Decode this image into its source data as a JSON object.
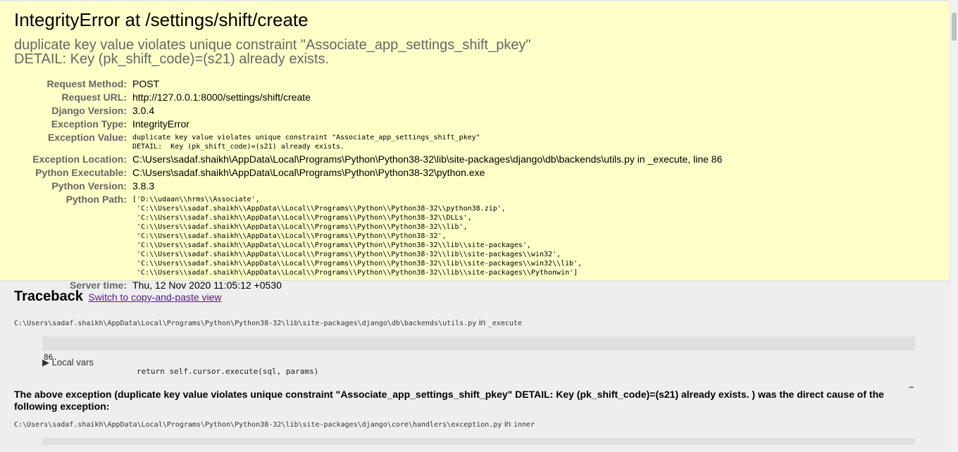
{
  "summary": {
    "title": "IntegrityError at /settings/shift/create",
    "message_line1": "duplicate key value violates unique constraint \"Associate_app_settings_shift_pkey\"",
    "message_line2": "DETAIL:  Key (pk_shift_code)=(s21) already exists.",
    "rows": {
      "request_method": {
        "label": "Request Method:",
        "value": "POST"
      },
      "request_url": {
        "label": "Request URL:",
        "value": "http://127.0.0.1:8000/settings/shift/create"
      },
      "django_version": {
        "label": "Django Version:",
        "value": "3.0.4"
      },
      "exception_type": {
        "label": "Exception Type:",
        "value": "IntegrityError"
      },
      "exception_value": {
        "label": "Exception Value:",
        "value": "duplicate key value violates unique constraint \"Associate_app_settings_shift_pkey\"\nDETAIL:  Key (pk_shift_code)=(s21) already exists."
      },
      "exception_location": {
        "label": "Exception Location:",
        "value": "C:\\Users\\sadaf.shaikh\\AppData\\Local\\Programs\\Python\\Python38-32\\lib\\site-packages\\django\\db\\backends\\utils.py in _execute, line 86"
      },
      "python_executable": {
        "label": "Python Executable:",
        "value": "C:\\Users\\sadaf.shaikh\\AppData\\Local\\Programs\\Python\\Python38-32\\python.exe"
      },
      "python_version": {
        "label": "Python Version:",
        "value": "3.8.3"
      },
      "python_path": {
        "label": "Python Path:",
        "value": "['D:\\\\udaan\\\\hrms\\\\Associate',\n 'C:\\\\Users\\\\sadaf.shaikh\\\\AppData\\\\Local\\\\Programs\\\\Python\\\\Python38-32\\\\python38.zip',\n 'C:\\\\Users\\\\sadaf.shaikh\\\\AppData\\\\Local\\\\Programs\\\\Python\\\\Python38-32\\\\DLLs',\n 'C:\\\\Users\\\\sadaf.shaikh\\\\AppData\\\\Local\\\\Programs\\\\Python\\\\Python38-32\\\\lib',\n 'C:\\\\Users\\\\sadaf.shaikh\\\\AppData\\\\Local\\\\Programs\\\\Python\\\\Python38-32',\n 'C:\\\\Users\\\\sadaf.shaikh\\\\AppData\\\\Local\\\\Programs\\\\Python\\\\Python38-32\\\\lib\\\\site-packages',\n 'C:\\\\Users\\\\sadaf.shaikh\\\\AppData\\\\Local\\\\Programs\\\\Python\\\\Python38-32\\\\lib\\\\site-packages\\\\win32',\n 'C:\\\\Users\\\\sadaf.shaikh\\\\AppData\\\\Local\\\\Programs\\\\Python\\\\Python38-32\\\\lib\\\\site-packages\\\\win32\\\\lib',\n 'C:\\\\Users\\\\sadaf.shaikh\\\\AppData\\\\Local\\\\Programs\\\\Python\\\\Python38-32\\\\lib\\\\site-packages\\\\Pythonwin']"
      },
      "server_time": {
        "label": "Server time:",
        "value": "Thu, 12 Nov 2020 11:05:12 +0530"
      }
    }
  },
  "traceback": {
    "heading": "Traceback",
    "switch_link": "Switch to copy-and-paste view",
    "frame1": {
      "file": "C:\\Users\\sadaf.shaikh\\AppData\\Local\\Programs\\Python\\Python38-32\\lib\\site-packages\\django\\db\\backends\\utils.py",
      "in_word": "in",
      "function": "_execute",
      "lineno": "86.",
      "code": "return self.cursor.execute(sql, params)",
      "ellipsis": "…",
      "local_vars": "▶ Local vars"
    },
    "cause_text": "The above exception (duplicate key value violates unique constraint \"Associate_app_settings_shift_pkey\" DETAIL: Key (pk_shift_code)=(s21) already exists. ) was the direct cause of the following exception:",
    "frame2": {
      "file": "C:\\Users\\sadaf.shaikh\\AppData\\Local\\Programs\\Python\\Python38-32\\lib\\site-packages\\django\\core\\handlers\\exception.py",
      "in_word": "in",
      "function": "inner"
    }
  },
  "colors": {
    "summary_bg": "#ffffc8",
    "page_bg": "#eeeeee",
    "context_bg": "#dfdfdf",
    "label_gray": "#666666",
    "link_visited": "#551a8b"
  }
}
